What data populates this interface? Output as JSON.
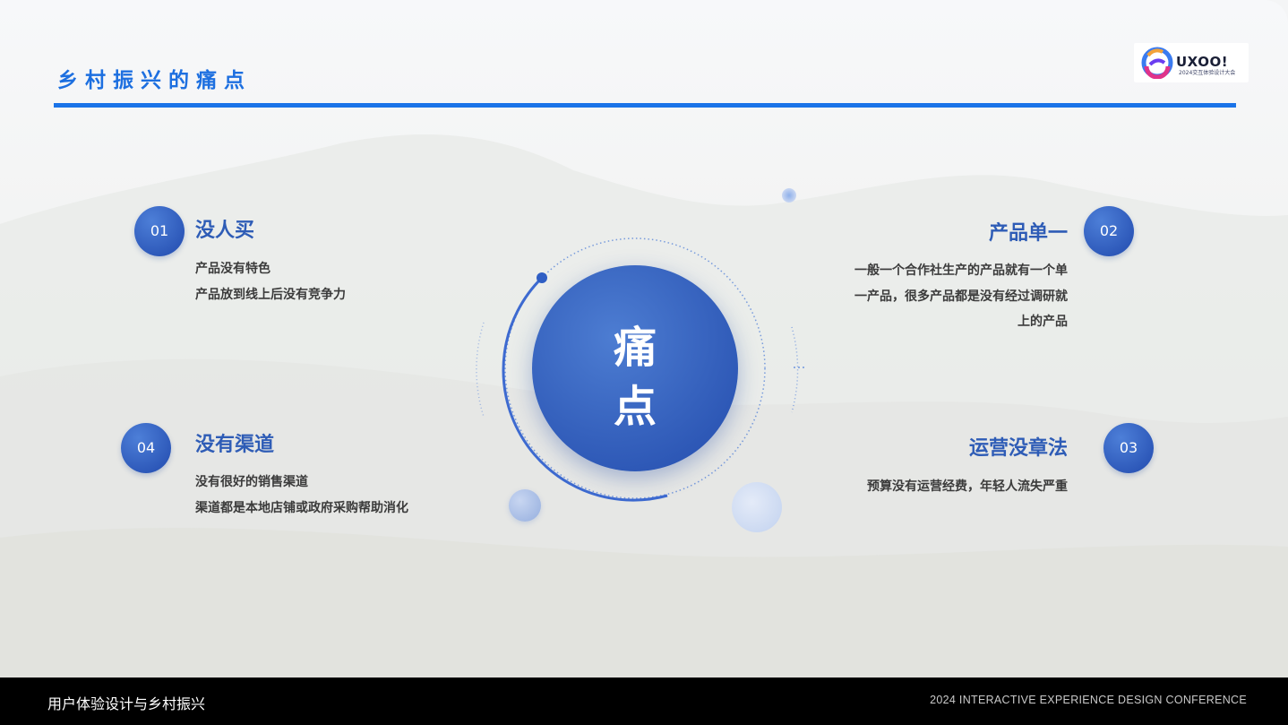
{
  "slide": {
    "title": "乡村振兴的痛点",
    "center_line1": "痛",
    "center_line2": "点"
  },
  "logo": {
    "wordmark": "UXOO!",
    "subtitle": "2024交互体验设计大会"
  },
  "points": [
    {
      "number": "01",
      "heading": "没人买",
      "lines": [
        "产品没有特色",
        "产品放到线上后没有竞争力"
      ]
    },
    {
      "number": "02",
      "heading": "产品单一",
      "lines": [
        "一般一个合作社生产的产品就有一个单",
        "一产品，很多产品都是没有经过调研就",
        "上的产品"
      ]
    },
    {
      "number": "03",
      "heading": "运营没章法",
      "lines": [
        "预算没有运营经费，年轻人流失严重"
      ]
    },
    {
      "number": "04",
      "heading": "没有渠道",
      "lines": [
        "没有很好的销售渠道",
        "渠道都是本地店铺或政府采购帮助消化"
      ]
    }
  ],
  "footer": {
    "left": "用户体验设计与乡村振兴",
    "right": "2024 INTERACTIVE EXPERIENCE DESIGN CONFERENCE"
  },
  "colors": {
    "accent": "#1a73e8",
    "heading": "#2e5cb6",
    "badge": "#2c57b8"
  }
}
